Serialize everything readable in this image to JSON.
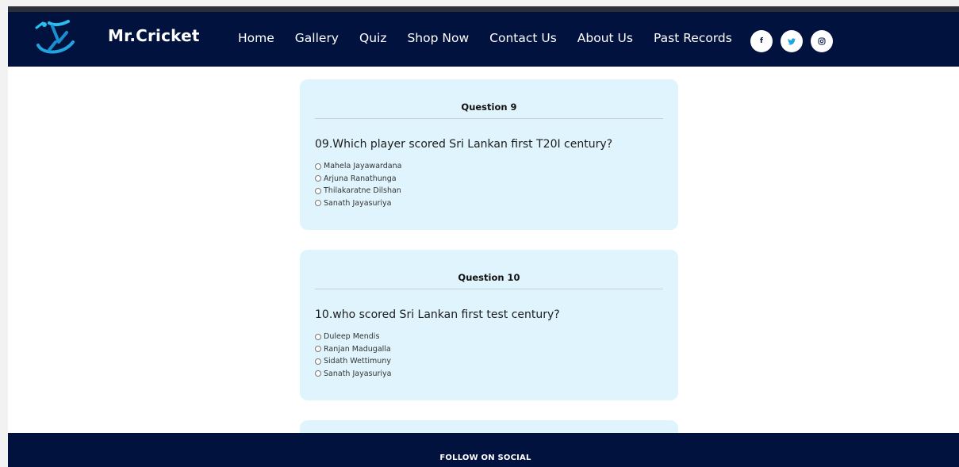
{
  "header": {
    "brand": "Mr.Cricket",
    "nav": [
      "Home",
      "Gallery",
      "Quiz",
      "Shop Now",
      "Contact Us",
      "About Us",
      "Past Records"
    ],
    "social": {
      "facebook": "f",
      "twitter_icon": "twitter-icon",
      "instagram_icon": "instagram-icon"
    }
  },
  "questions": [
    {
      "title": "Question 9",
      "text": "09.Which player scored Sri Lankan first T20I century?",
      "options": [
        "Mahela Jayawardana",
        "Arjuna Ranathunga",
        "Thilakaratne Dilshan",
        "Sanath Jayasuriya"
      ]
    },
    {
      "title": "Question 10",
      "text": "10.who scored Sri Lankan first test century?",
      "options": [
        "Duleep Mendis",
        "Ranjan Madugalla",
        "Sidath Wettimuny",
        "Sanath Jayasuriya"
      ]
    }
  ],
  "footer": {
    "title": "FOLLOW ON SOCIAL"
  },
  "colors": {
    "navy": "#02123f",
    "card": "#dff4fc",
    "logo_accent": "#1fa6e0"
  }
}
